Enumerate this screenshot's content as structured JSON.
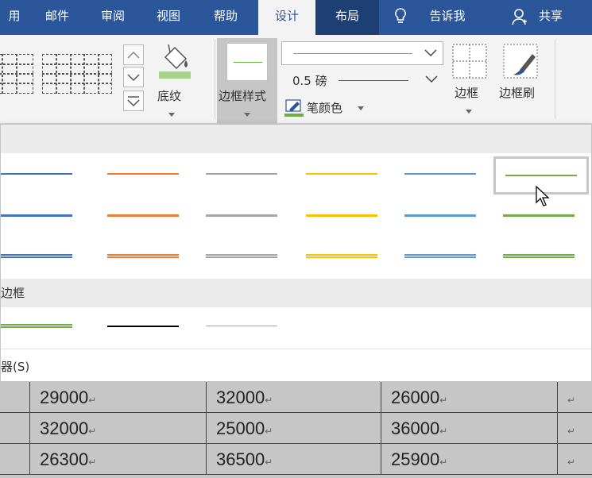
{
  "tabs": [
    {
      "label": "用"
    },
    {
      "label": "邮件"
    },
    {
      "label": "审阅"
    },
    {
      "label": "视图"
    },
    {
      "label": "帮助"
    },
    {
      "label": "设计"
    },
    {
      "label": "布局"
    },
    {
      "label": "告诉我"
    },
    {
      "label": "共享"
    }
  ],
  "ribbon": {
    "shading_label": "底纹",
    "border_styles_label": "边框样式",
    "line_weight_value": "0.5 磅",
    "pen_color_label": "笔颜色",
    "borders_label": "边框",
    "border_painter_label": "边框刷"
  },
  "colors": {
    "blue": "#4472c4",
    "orange": "#ed7d31",
    "gray": "#a5a5a5",
    "gold": "#ffc000",
    "lightblue": "#5b9bd5",
    "green": "#70ad47",
    "black": "#000000",
    "accent": "#2b579a"
  },
  "panel": {
    "section2_title": "边框",
    "footer_link": "器(S)"
  },
  "table": {
    "rows": [
      [
        "29000",
        "32000",
        "26000"
      ],
      [
        "32000",
        "25000",
        "36000"
      ],
      [
        "26300",
        "36500",
        "25900"
      ]
    ]
  }
}
